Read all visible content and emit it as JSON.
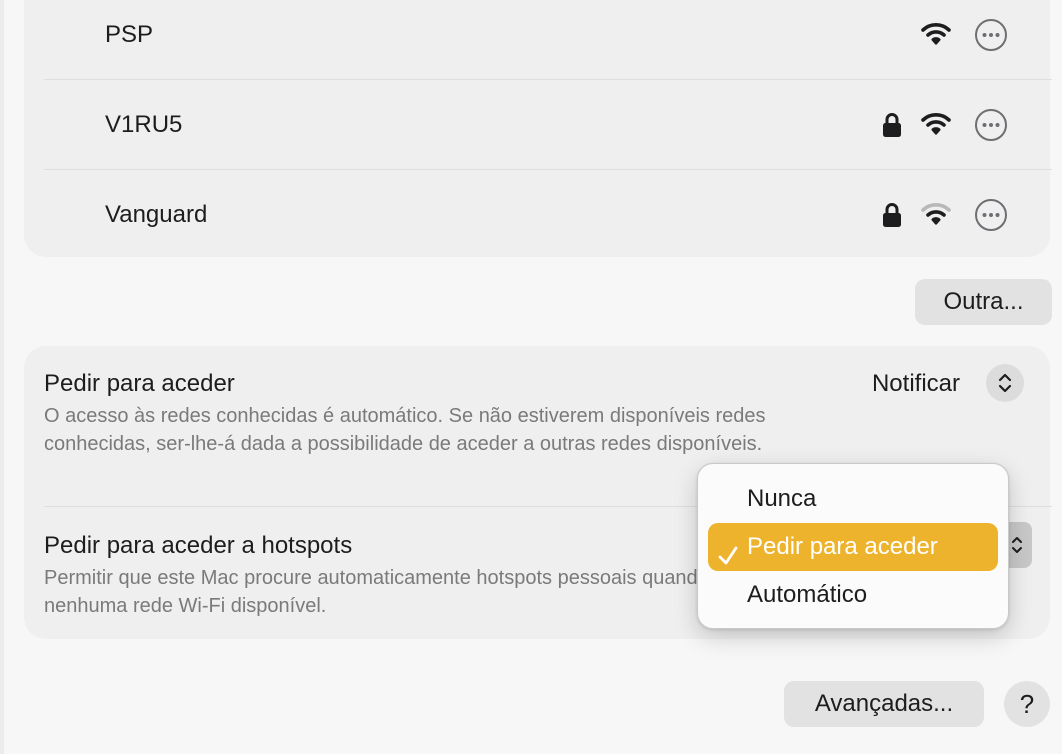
{
  "networks": [
    {
      "name": "PSP",
      "locked": false,
      "signal": "strong"
    },
    {
      "name": "V1RU5",
      "locked": true,
      "signal": "strong"
    },
    {
      "name": "Vanguard",
      "locked": true,
      "signal": "medium"
    }
  ],
  "buttons": {
    "other_label": "Outra...",
    "advanced_label": "Avançadas...",
    "help_label": "?"
  },
  "settings": {
    "ask_join": {
      "title": "Pedir para aceder",
      "description": "O acesso às redes conhecidas é automático. Se não estiverem disponíveis redes conhecidas, ser-lhe-á dada a possibilidade de aceder a outras redes disponíveis.",
      "value": "Notificar"
    },
    "ask_hotspots": {
      "title": "Pedir para aceder a hotspots",
      "description": "Permitir que este Mac procure automaticamente hotspots pessoais quando não houver nenhuma rede Wi-Fi disponível."
    }
  },
  "popup_menu": {
    "items": [
      {
        "label": "Nunca",
        "selected": false
      },
      {
        "label": "Pedir para aceder",
        "selected": true
      },
      {
        "label": "Automático",
        "selected": false
      }
    ]
  },
  "colors": {
    "accent": "#eeb32c",
    "background": "#f7f7f7",
    "card": "#efefef"
  },
  "icons": [
    "lock-icon",
    "wifi-icon",
    "more-icon",
    "stepper-icon",
    "checkmark-icon"
  ]
}
